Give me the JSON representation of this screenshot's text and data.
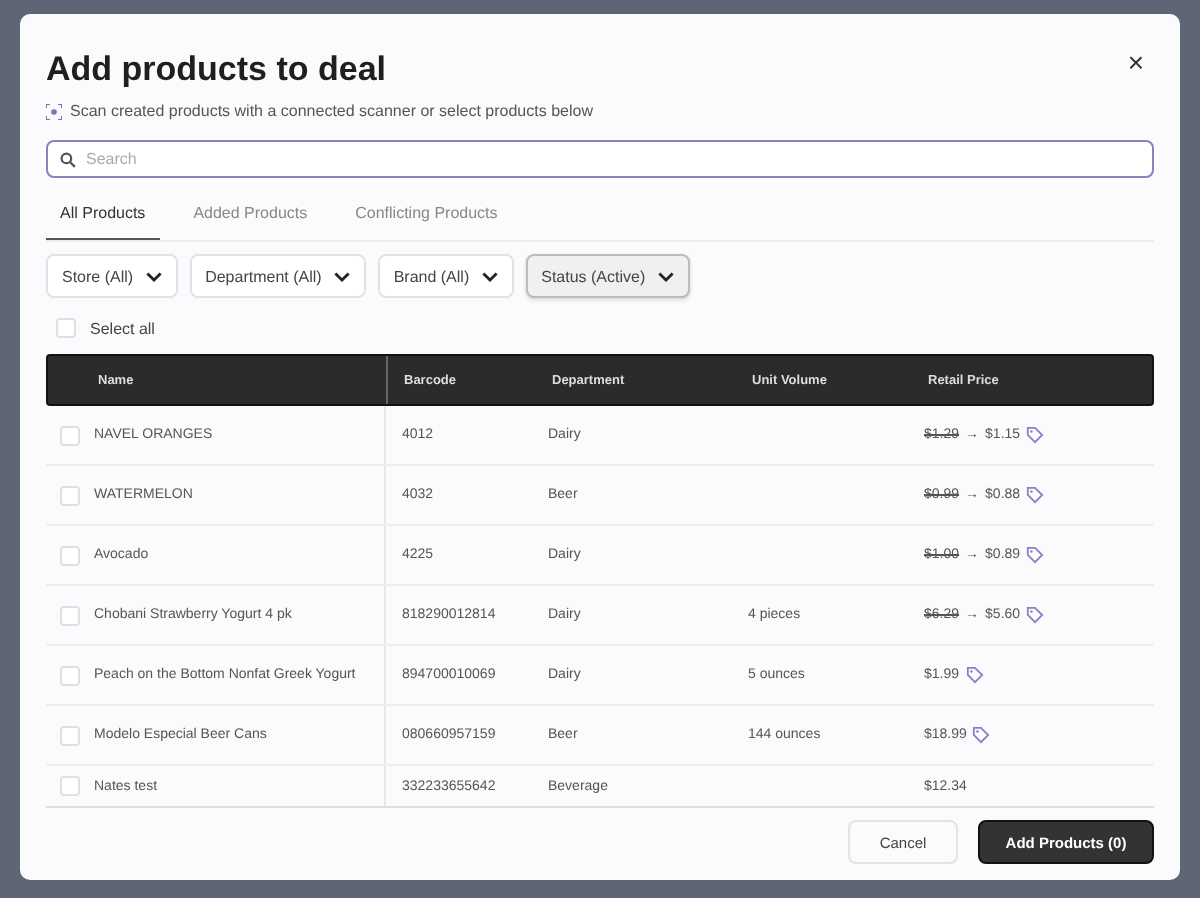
{
  "dialog": {
    "title": "Add products to deal",
    "subtitle": "Scan created products with a connected scanner or select products below",
    "close": "×"
  },
  "search": {
    "placeholder": "Search"
  },
  "tabs": [
    {
      "label": "All Products",
      "selected": true
    },
    {
      "label": "Added Products",
      "selected": false
    },
    {
      "label": "Conflicting Products",
      "selected": false
    }
  ],
  "filters": [
    {
      "label": "Store (All)",
      "active": false
    },
    {
      "label": "Department (All)",
      "active": false
    },
    {
      "label": "Brand (All)",
      "active": false
    },
    {
      "label": "Status (Active)",
      "active": true
    }
  ],
  "select_all": {
    "label": "Select all",
    "checked": false
  },
  "table": {
    "columns": [
      "Name",
      "Barcode",
      "Department",
      "Unit Volume",
      "Retail Price"
    ],
    "rows": [
      {
        "checked": false,
        "name": "NAVEL ORANGES",
        "barcode": "4012",
        "department": "Dairy",
        "unit_volume": "",
        "old_price": "$1.29",
        "arrow": "→",
        "price": "$1.15",
        "tagged": true
      },
      {
        "checked": false,
        "name": "WATERMELON",
        "barcode": "4032",
        "department": "Beer",
        "unit_volume": "",
        "old_price": "$0.99",
        "arrow": "→",
        "price": "$0.88",
        "tagged": true
      },
      {
        "checked": false,
        "name": "Avocado",
        "barcode": "4225",
        "department": "Dairy",
        "unit_volume": "",
        "old_price": "$1.00",
        "arrow": "→",
        "price": "$0.89",
        "tagged": true
      },
      {
        "checked": false,
        "name": "Chobani Strawberry Yogurt 4 pk",
        "barcode": "818290012814",
        "department": "Dairy",
        "unit_volume": "4 pieces",
        "old_price": "$6.29",
        "arrow": "→",
        "price": "$5.60",
        "tagged": true
      },
      {
        "checked": false,
        "name": "Peach on the Bottom Nonfat Greek Yogurt",
        "barcode": "894700010069",
        "department": "Dairy",
        "unit_volume": "5 ounces",
        "old_price": "",
        "arrow": "",
        "price": "$1.99",
        "tagged": true
      },
      {
        "checked": false,
        "name": "Modelo Especial Beer Cans",
        "barcode": "080660957159",
        "department": "Beer",
        "unit_volume": "144 ounces",
        "old_price": "",
        "arrow": "",
        "price": "$18.99",
        "tagged": true
      },
      {
        "checked": false,
        "name": "Nates test",
        "barcode": "332233655642",
        "department": "Beverage",
        "unit_volume": "",
        "old_price": "",
        "arrow": "",
        "price": "$12.34",
        "tagged": false
      }
    ]
  },
  "footer": {
    "cancel": "Cancel",
    "submit": "Add Products (0)"
  }
}
